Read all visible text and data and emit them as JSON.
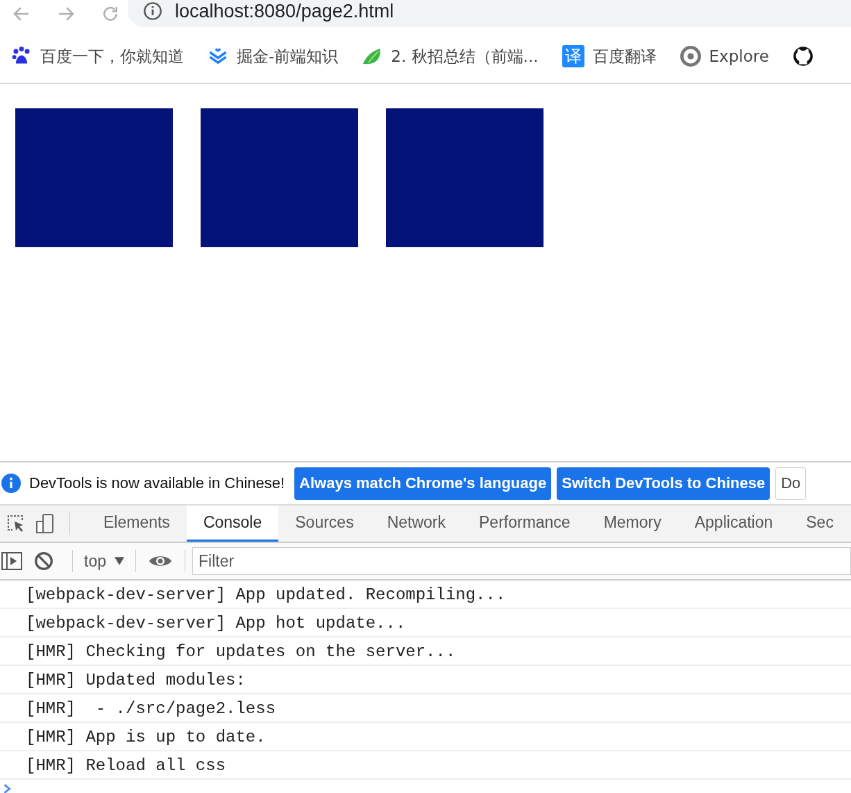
{
  "address_bar": {
    "url": "localhost:8080/page2.html"
  },
  "bookmarks": [
    {
      "label": "百度一下，你就知道",
      "kind": "paw"
    },
    {
      "label": "掘金-前端知识",
      "kind": "chevrons"
    },
    {
      "label": "2. 秋招总结（前端...",
      "kind": "bird"
    },
    {
      "label": "百度翻译",
      "kind": "glyph",
      "glyph": "译"
    },
    {
      "label": "Explore",
      "kind": "ring"
    },
    {
      "kind": "github"
    }
  ],
  "page": {
    "blocks": [
      {
        "kind": "block"
      },
      {
        "kind": "block"
      },
      {
        "kind": "block"
      }
    ]
  },
  "devtools": {
    "infobar": {
      "message": "DevTools is now available in Chinese!",
      "buttons": [
        {
          "label": "Always match Chrome's language",
          "kind": "primary"
        },
        {
          "label": "Switch DevTools to Chinese",
          "kind": "primary"
        },
        {
          "label": "Do",
          "kind": "plain"
        }
      ]
    },
    "tabs": [
      {
        "label": "Elements",
        "selected": false
      },
      {
        "label": "Console",
        "selected": true
      },
      {
        "label": "Sources",
        "selected": false
      },
      {
        "label": "Network",
        "selected": false
      },
      {
        "label": "Performance",
        "selected": false
      },
      {
        "label": "Memory",
        "selected": false
      },
      {
        "label": "Application",
        "selected": false
      },
      {
        "label": "Sec",
        "selected": false
      }
    ],
    "context": "top",
    "filter": {
      "placeholder": "Filter"
    },
    "console_lines": [
      "[webpack-dev-server] App updated. Recompiling...",
      "[webpack-dev-server] App hot update...",
      "[HMR] Checking for updates on the server...",
      "[HMR] Updated modules:",
      "[HMR]  - ./src/page2.less",
      "[HMR] App is up to date.",
      "[HMR] Reload all css"
    ]
  }
}
